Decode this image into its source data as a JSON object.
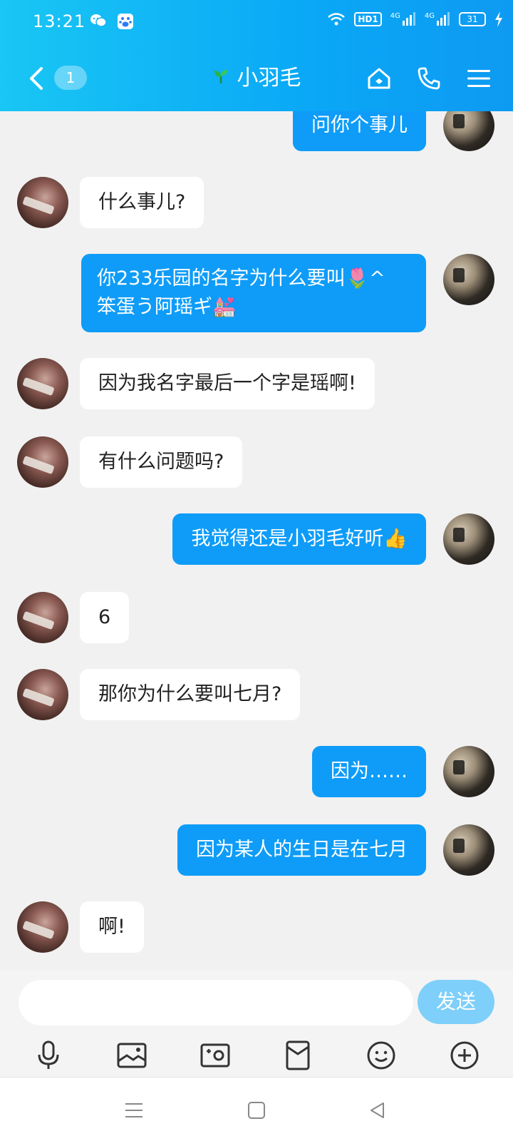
{
  "status_bar": {
    "time": "13:21",
    "hd_label": "HD1",
    "net1": "4G",
    "net2": "4G",
    "battery": "31"
  },
  "header": {
    "unread_count": "1",
    "contact_name": "小羽毛",
    "sprout_icon": "sprout-icon",
    "accent": "#0aa8f6"
  },
  "messages": [
    {
      "side": "right",
      "text": "问你个事儿"
    },
    {
      "side": "left",
      "text": "什么事儿?"
    },
    {
      "side": "right",
      "text": "你233乐园的名字为什么要叫🌷^ 笨蛋う阿瑶ギ💒"
    },
    {
      "side": "left",
      "text": "因为我名字最后一个字是瑶啊!"
    },
    {
      "side": "left",
      "text": "有什么问题吗?"
    },
    {
      "side": "right",
      "text": "我觉得还是小羽毛好听👍"
    },
    {
      "side": "left",
      "text": "6"
    },
    {
      "side": "left",
      "text": "那你为什么要叫七月?"
    },
    {
      "side": "right",
      "text": "因为……"
    },
    {
      "side": "right",
      "text": "因为某人的生日是在七月"
    },
    {
      "side": "left",
      "text": "啊!"
    }
  ],
  "composer": {
    "placeholder": "",
    "send_label": "发送",
    "send_color": "#7ecff9"
  },
  "bubble_colors": {
    "sent": "#0e9cf8",
    "received": "#ffffff"
  }
}
